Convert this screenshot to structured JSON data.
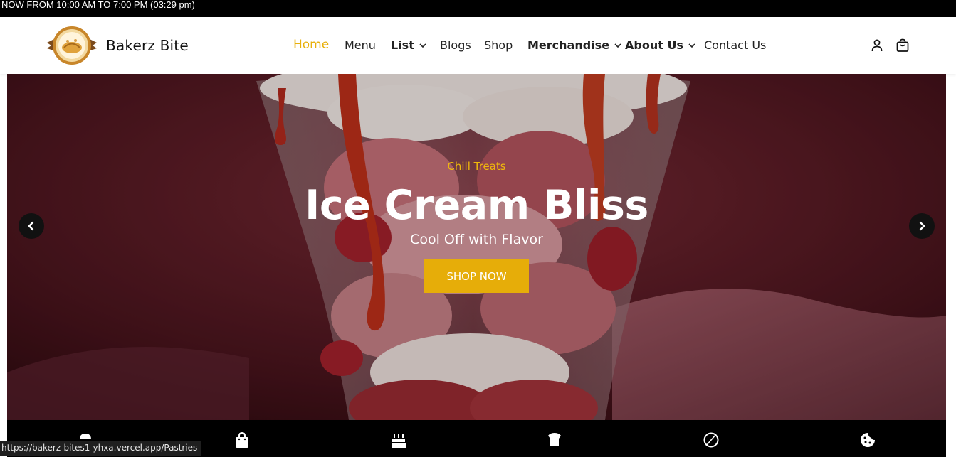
{
  "topbar": {
    "hours_text": "NOW FROM 10:00 AM TO 7:00 PM (03:29 pm)"
  },
  "brand": {
    "name": "Bakerz Bite",
    "logo_icon": "bakery-logo-icon"
  },
  "nav": {
    "items": [
      {
        "label": "Home",
        "active": true,
        "dropdown": false
      },
      {
        "label": "Menu",
        "active": false,
        "dropdown": false
      },
      {
        "label": "List",
        "active": false,
        "dropdown": true
      },
      {
        "label": "Blogs",
        "active": false,
        "dropdown": false
      },
      {
        "label": "Shop",
        "active": false,
        "dropdown": false
      },
      {
        "label": "Merchandise",
        "active": false,
        "dropdown": true
      },
      {
        "label": "About Us",
        "active": false,
        "dropdown": true
      },
      {
        "label": "Contact Us",
        "active": false,
        "dropdown": false
      }
    ],
    "icons": [
      "user-icon",
      "shopping-bag-icon"
    ]
  },
  "hero": {
    "eyebrow": "Chill Treats",
    "title": "Ice Cream Bliss",
    "subtitle": "Cool Off with Flavor",
    "button_label": "SHOP NOW",
    "prev_icon": "chevron-left-icon",
    "next_icon": "chevron-right-icon"
  },
  "categories": {
    "icons": [
      "muffin-icon",
      "shopping-bag-icon",
      "birthday-cake-icon",
      "chef-hat-icon",
      "compass-icon",
      "cookie-icon"
    ]
  },
  "status_bar": {
    "url": "https://bakerz-bites1-yhxa.vercel.app/Pastries"
  },
  "colors": {
    "accent": "#e8b00c",
    "button": "#e6ad09",
    "dark": "#000000"
  }
}
